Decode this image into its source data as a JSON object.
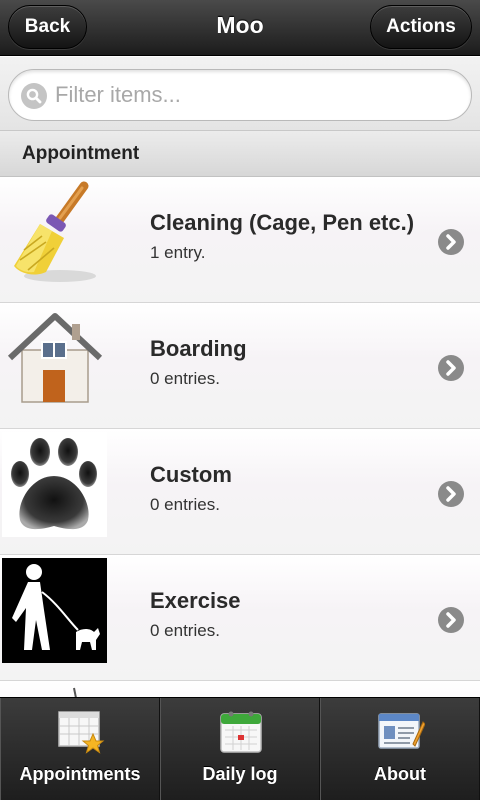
{
  "header": {
    "title": "Moo",
    "back_label": "Back",
    "actions_label": "Actions"
  },
  "search": {
    "placeholder": "Filter items...",
    "value": ""
  },
  "section": {
    "title": "Appointment"
  },
  "items": [
    {
      "name": "Cleaning (Cage, Pen etc.)",
      "count": "1 entry.",
      "icon": "broom-icon"
    },
    {
      "name": "Boarding",
      "count": "0 entries.",
      "icon": "house-icon"
    },
    {
      "name": "Custom",
      "count": "0 entries.",
      "icon": "paw-icon"
    },
    {
      "name": "Exercise",
      "count": "0 entries.",
      "icon": "dog-walking-icon"
    }
  ],
  "tabs": [
    {
      "label": "Appointments",
      "icon": "calendar-star-icon"
    },
    {
      "label": "Daily log",
      "icon": "calendar-icon"
    },
    {
      "label": "About",
      "icon": "info-card-icon"
    }
  ],
  "colors": {
    "header_bg": "#1c1c1c",
    "tabbar_bg": "#2b2b2b",
    "chevron": "#8a8a8a"
  }
}
